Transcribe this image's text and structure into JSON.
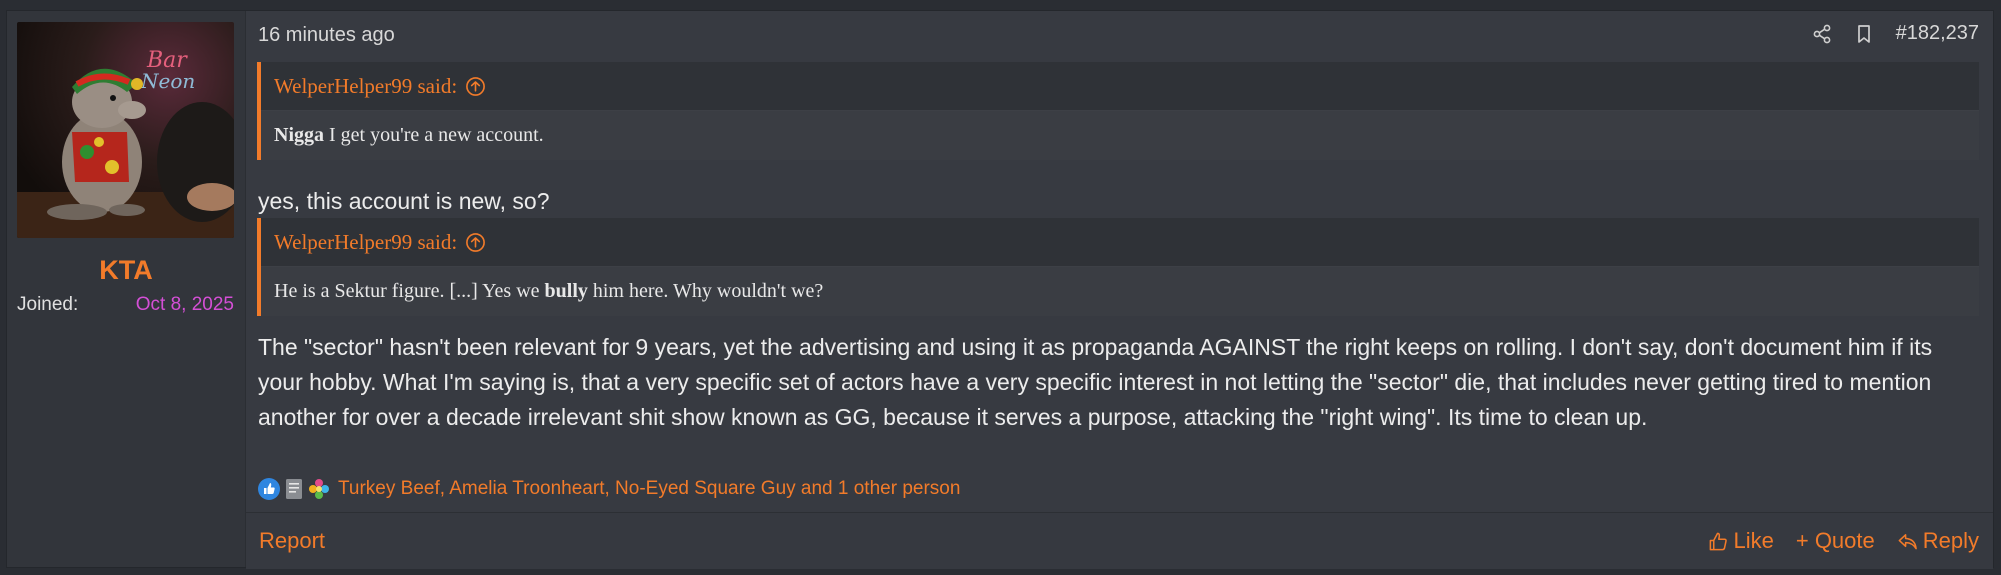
{
  "user": {
    "name": "KTA",
    "joined_label": "Joined:",
    "joined_date": "Oct 8, 2025"
  },
  "post": {
    "timestamp": "16 minutes ago",
    "number": "#182,237",
    "quote1": {
      "author": "WelperHelper99 said:",
      "bold": "Nigga",
      "text": " I get you're a new account."
    },
    "reply1": "yes, this account is new, so?",
    "quote2": {
      "author": "WelperHelper99 said:",
      "text_a": "He is a Sektur figure. [...] Yes we ",
      "bold": "bully",
      "text_b": " him here. Why wouldn't we?"
    },
    "reply2": "The \"sector\" hasn't been relevant for 9 years, yet the advertising and using it as propaganda AGAINST the right keeps on rolling. I don't say, don't document him if its your hobby. What I'm saying is, that a very specific set of actors have a very specific interest in not letting the \"sector\" die, that includes never getting tired to mention another for over a decade irrelevant shit show known as GG, because it serves a purpose, attacking the \"right wing\". Its time to clean up.",
    "reactors": "Turkey Beef, Amelia Troonheart, No-Eyed Square Guy and 1 other person"
  },
  "actions": {
    "report": "Report",
    "like": "Like",
    "quote": "+ Quote",
    "reply": "Reply"
  },
  "icons": {
    "share": "share-icon",
    "bookmark": "bookmark-icon",
    "quote_jump": "arrow-up-circle-icon",
    "like": "thumbs-up-icon",
    "reply": "reply-arrow-icon"
  },
  "colors": {
    "accent": "#f27b2a",
    "joined_date": "#d44fd6",
    "background": "#373a41"
  }
}
